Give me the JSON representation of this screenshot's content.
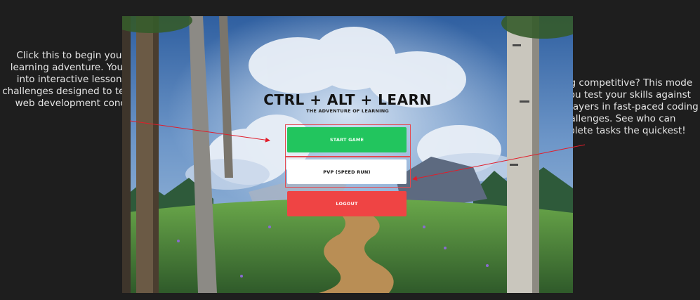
{
  "game": {
    "title": "CTRL + ALT + LEARN",
    "subtitle": "THE ADVENTURE OF LEARNING",
    "buttons": {
      "start": "START GAME",
      "pvp": "PVP (SPEED RUN)",
      "logout": "LOGOUT"
    }
  },
  "annotations": {
    "left": "Click this to begin your solo learning adventure. You'll dive into interactive lessons and challenges designed to teach you web development concepts.",
    "right": "Feeling competitive?  This mode lets you test your skills against other players in fast-paced coding challenges. See who can complete tasks the quickest!"
  },
  "colors": {
    "page_bg": "#1e1e1e",
    "start": "#22c55e",
    "pvp": "#ffffff",
    "logout": "#ef4444",
    "annotation_line": "#e11d2a"
  }
}
